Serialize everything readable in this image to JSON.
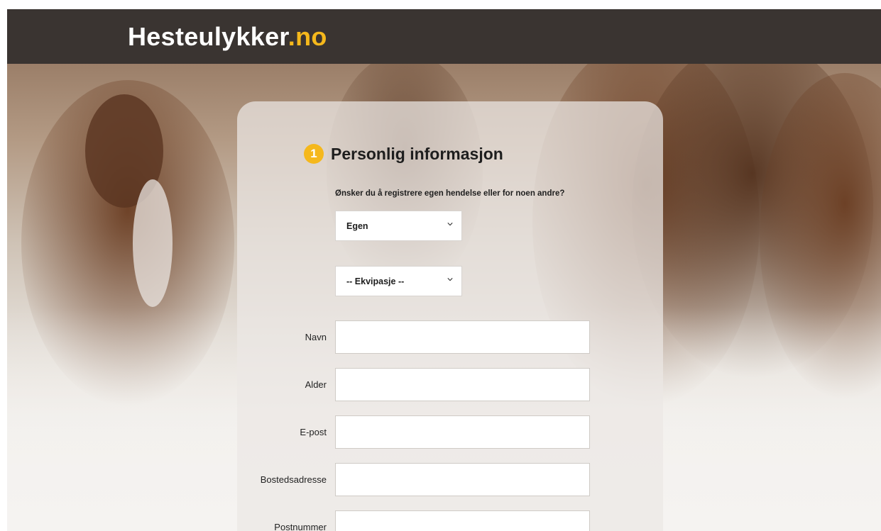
{
  "header": {
    "logo_main": "Hesteulykker",
    "logo_tld": ".no"
  },
  "colors": {
    "accent": "#f5b81c",
    "header_bg": "#3a3431"
  },
  "form": {
    "step_number": "1",
    "title": "Personlig informasjon",
    "question": "Ønsker du å registrere egen hendelse eller for noen andre?",
    "select_registration": {
      "selected": "Egen"
    },
    "select_equipage": {
      "selected": "-- Ekvipasje --"
    },
    "fields": {
      "navn": {
        "label": "Navn",
        "value": ""
      },
      "alder": {
        "label": "Alder",
        "value": ""
      },
      "epost": {
        "label": "E-post",
        "value": ""
      },
      "bostedsadresse": {
        "label": "Bostedsadresse",
        "value": ""
      },
      "postnummer": {
        "label": "Postnummer",
        "value": ""
      }
    }
  }
}
